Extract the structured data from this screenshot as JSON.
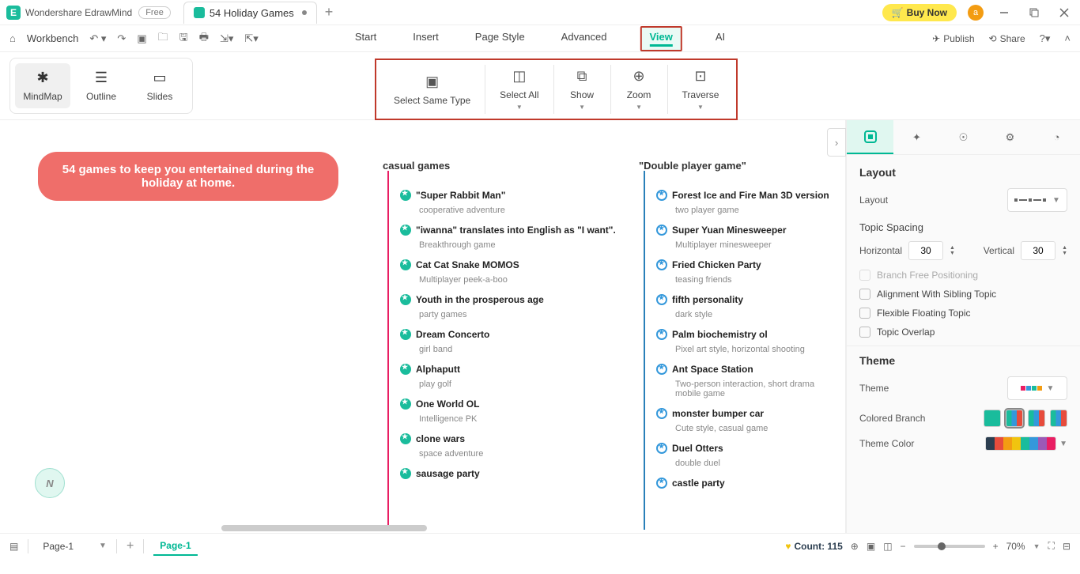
{
  "title": {
    "app": "Wondershare EdrawMind",
    "badge": "Free",
    "doc": "54 Holiday Games"
  },
  "titlebar": {
    "buy": "Buy Now",
    "avatar": "a"
  },
  "quick": {
    "workbench": "Workbench"
  },
  "menu": {
    "start": "Start",
    "insert": "Insert",
    "pagestyle": "Page Style",
    "advanced": "Advanced",
    "view": "View",
    "ai": "AI"
  },
  "share": {
    "publish": "Publish",
    "share": "Share"
  },
  "modes": {
    "mindmap": "MindMap",
    "outline": "Outline",
    "slides": "Slides"
  },
  "tools": {
    "selectsame": "Select Same Type",
    "selectall": "Select All",
    "show": "Show",
    "zoom": "Zoom",
    "traverse": "Traverse"
  },
  "root": "54 games to keep you entertained during the holiday at home.",
  "col1": {
    "title": "casual games"
  },
  "col2": {
    "title": "\"Double player game\""
  },
  "c1": [
    {
      "t": "\"Super Rabbit Man\"",
      "s": "cooperative adventure"
    },
    {
      "t": "\"iwanna\" translates into English as \"I want\".",
      "s": "Breakthrough game"
    },
    {
      "t": "Cat Cat Snake MOMOS",
      "s": "Multiplayer peek-a-boo"
    },
    {
      "t": "Youth in the prosperous age",
      "s": "party games"
    },
    {
      "t": "Dream Concerto",
      "s": "girl band"
    },
    {
      "t": "Alphaputt",
      "s": "play golf"
    },
    {
      "t": "One World OL",
      "s": "Intelligence PK"
    },
    {
      "t": "clone wars",
      "s": "space adventure"
    },
    {
      "t": "sausage party",
      "s": ""
    }
  ],
  "c2": [
    {
      "t": "Forest Ice and Fire Man 3D version",
      "s": "two player game"
    },
    {
      "t": "Super Yuan Minesweeper",
      "s": "Multiplayer minesweeper"
    },
    {
      "t": "Fried Chicken Party",
      "s": "teasing friends"
    },
    {
      "t": "fifth personality",
      "s": "dark style"
    },
    {
      "t": "Palm biochemistry ol",
      "s": "Pixel art style, horizontal shooting"
    },
    {
      "t": "Ant Space Station",
      "s": "Two-person interaction, short drama mobile game"
    },
    {
      "t": "monster bumper car",
      "s": "Cute style, casual game"
    },
    {
      "t": "Duel Otters",
      "s": "double duel"
    },
    {
      "t": "castle party",
      "s": ""
    }
  ],
  "panel": {
    "layout": "Layout",
    "spacing": "Topic Spacing",
    "horizontal": "Horizontal",
    "hval": "30",
    "vertical": "Vertical",
    "vval": "30",
    "free": "Branch Free Positioning",
    "align": "Alignment With Sibling Topic",
    "float": "Flexible Floating Topic",
    "overlap": "Topic Overlap",
    "theme": "Theme",
    "themelbl": "Theme",
    "branch": "Colored Branch",
    "color": "Theme Color"
  },
  "status": {
    "pagesel": "Page-1",
    "pagetab": "Page-1",
    "count": "Count: 115",
    "zoom": "70%"
  }
}
